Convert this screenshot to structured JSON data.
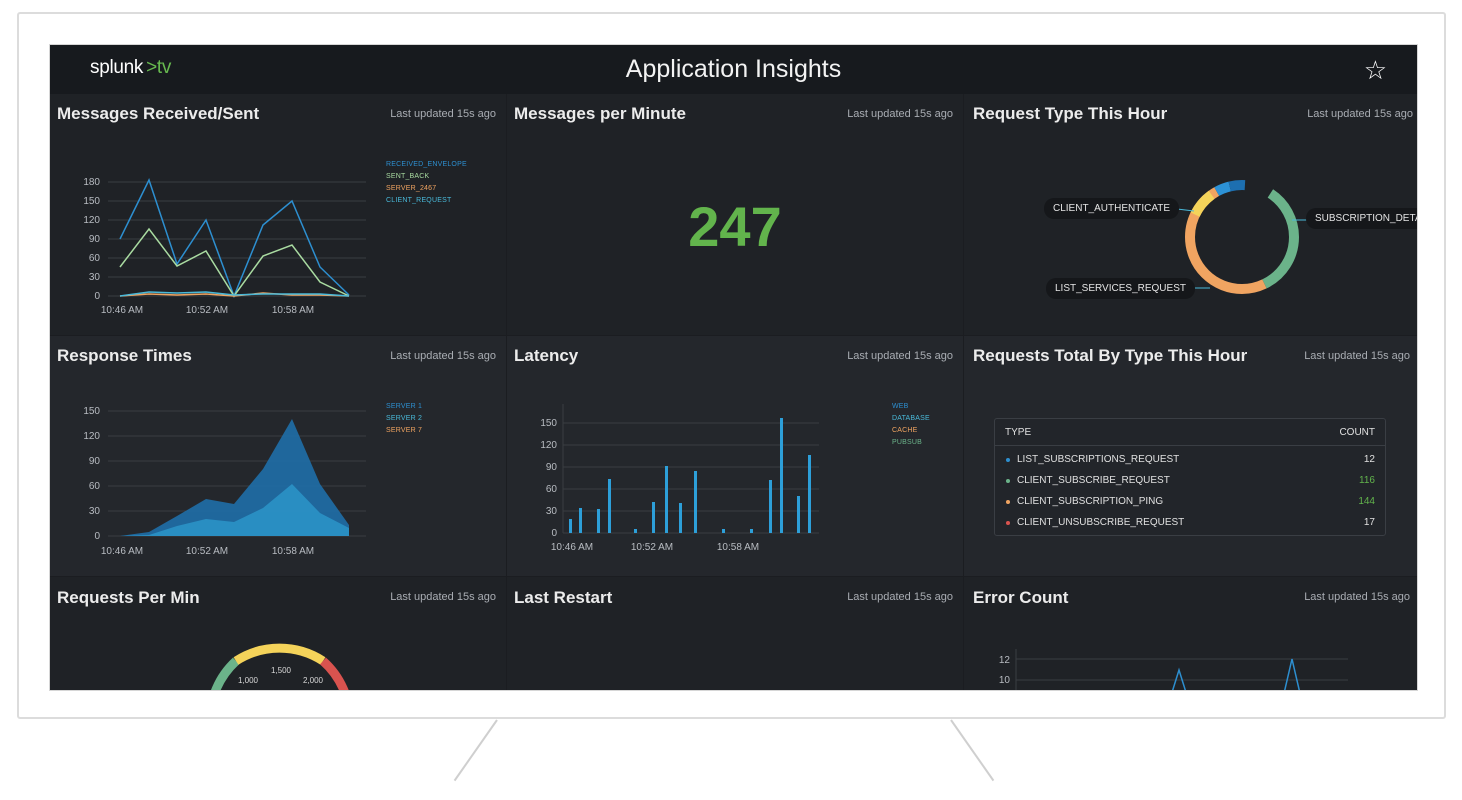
{
  "header": {
    "brand_name": "splunk",
    "brand_gt": ">",
    "brand_suffix": "tv",
    "title": "Application Insights",
    "star_icon": "star-icon"
  },
  "updated_label": "Last updated 15s ago",
  "colors": {
    "background": "#1b1d21",
    "accent_green": "#62b44c",
    "series_blue": "#2d8fd0",
    "series_lightgreen": "#a9dba1",
    "series_orange": "#f0a461",
    "series_cyan": "#49b9d9",
    "donut_green": "#6bb38a",
    "donut_orange": "#f0a461",
    "donut_yellow": "#f4d35a",
    "donut_blue": "#2c92d6",
    "status_red": "#d9534f"
  },
  "panels": {
    "messages": {
      "title": "Messages Received/Sent",
      "legend": [
        "RECEIVED_ENVELOPE",
        "SENT_BACK",
        "SERVER_2467",
        "CLIENT_REQUEST"
      ],
      "legend_colors": [
        "#2d8fd0",
        "#a9dba1",
        "#f0a461",
        "#49b9d9"
      ],
      "y_ticks": [
        "180",
        "150",
        "120",
        "90",
        "60",
        "30",
        "0"
      ],
      "x_ticks": [
        "10:46 AM",
        "10:52 AM",
        "10:58 AM"
      ]
    },
    "mpm": {
      "title": "Messages per Minute",
      "value": "247"
    },
    "request_type": {
      "title": "Request Type This Hour",
      "labels": [
        "CLIENT_AUTHENTICATE",
        "SUBSCRIPTION_DETAILS",
        "LIST_SERVICES_REQUEST"
      ]
    },
    "response": {
      "title": "Response Times",
      "legend": [
        "SERVER 1",
        "SERVER 2",
        "SERVER 7"
      ],
      "legend_colors": [
        "#2d8fd0",
        "#49b9d9",
        "#f0a461"
      ],
      "y_ticks": [
        "150",
        "120",
        "90",
        "60",
        "30",
        "0"
      ],
      "x_ticks": [
        "10:46 AM",
        "10:52 AM",
        "10:58 AM"
      ]
    },
    "latency": {
      "title": "Latency",
      "legend": [
        "WEB",
        "DATABASE",
        "CACHE",
        "PUBSUB"
      ],
      "legend_colors": [
        "#2d8fd0",
        "#49b9d9",
        "#f0a461",
        "#6bb38a"
      ],
      "y_ticks": [
        "150",
        "120",
        "90",
        "60",
        "30",
        "0"
      ],
      "x_ticks": [
        "10:46 AM",
        "10:52 AM",
        "10:58 AM"
      ]
    },
    "requests_total": {
      "title": "Requests Total By Type This Hour",
      "col_type": "TYPE",
      "col_count": "COUNT",
      "rows": [
        {
          "type": "LIST_SUBSCRIPTIONS_REQUEST",
          "count": "12",
          "dot": "#2d8fd0",
          "count_color": "#e0e0e0"
        },
        {
          "type": "CLIENT_SUBSCRIBE_REQUEST",
          "count": "116",
          "dot": "#6bb38a",
          "count_color": "#62b44c"
        },
        {
          "type": "CLIENT_SUBSCRIPTION_PING",
          "count": "144",
          "dot": "#f0a461",
          "count_color": "#62b44c"
        },
        {
          "type": "CLIENT_UNSUBSCRIBE_REQUEST",
          "count": "17",
          "dot": "#d9534f",
          "count_color": "#e0e0e0"
        }
      ]
    },
    "requests_per_min": {
      "title": "Requests Per Min",
      "gauge_ticks": [
        "1,000",
        "1,500",
        "2,000"
      ]
    },
    "last_restart": {
      "title": "Last Restart"
    },
    "error_count": {
      "title": "Error Count",
      "y_ticks": [
        "12",
        "10"
      ]
    }
  }
}
